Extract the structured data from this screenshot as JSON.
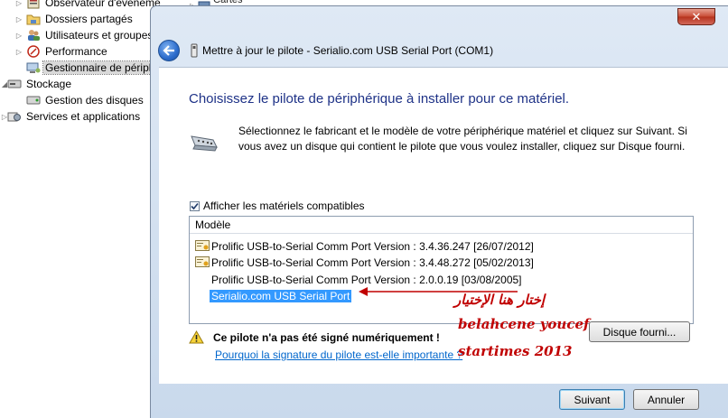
{
  "tree": {
    "items": [
      {
        "label": "Observateur d'événeme",
        "icon": "event-viewer-icon",
        "expander": "▷"
      },
      {
        "label": "Dossiers partagés",
        "icon": "shared-folder-icon",
        "expander": "▷"
      },
      {
        "label": "Utilisateurs et groupes",
        "icon": "users-icon",
        "expander": "▷"
      },
      {
        "label": "Performance",
        "icon": "performance-icon",
        "expander": "▷"
      },
      {
        "label": "Gestionnaire de périph",
        "icon": "device-manager-icon",
        "expander": ""
      },
      {
        "label": "Stockage",
        "icon": "storage-icon",
        "expander": "◢"
      },
      {
        "label": "Gestion des disques",
        "icon": "disk-icon",
        "expander": ""
      },
      {
        "label": "Services et applications",
        "icon": "services-icon",
        "expander": "▷"
      }
    ],
    "background_item": "Cartes réseau"
  },
  "dialog": {
    "close_label": "✕",
    "title": "Mettre à jour le pilote - Serialio.com USB Serial Port (COM1)",
    "heading": "Choisissez le pilote de périphérique à installer pour ce matériel.",
    "instructions": "Sélectionnez le fabricant et le modèle de votre périphérique matériel et cliquez sur Suivant. Si vous avez un disque qui contient le pilote que vous voulez installer, cliquez sur Disque fourni.",
    "show_compatible": {
      "label": "Afficher les matériels compatibles",
      "checked": true
    },
    "model_list": {
      "header": "Modèle",
      "rows": [
        {
          "label": "Prolific USB-to-Serial Comm Port Version : 3.4.36.247 [26/07/2012]",
          "icon": "certificate-icon",
          "selected": false
        },
        {
          "label": "Prolific USB-to-Serial Comm Port Version : 3.4.48.272 [05/02/2013]",
          "icon": "certificate-icon",
          "selected": false
        },
        {
          "label": "Prolific USB-to-Serial Comm Port Version : 2.0.0.19 [03/08/2005]",
          "icon": "",
          "selected": false
        },
        {
          "label": "Serialio.com USB Serial Port",
          "icon": "",
          "selected": true
        }
      ]
    },
    "warning": "Ce pilote n'a pas été signé numériquement !",
    "why_link": "Pourquoi la signature du pilote est-elle importante ?",
    "have_disk_label": "Disque fourni...",
    "next_label": "Suivant",
    "cancel_label": "Annuler"
  },
  "annotations": {
    "line1": "إختار هنا الإختيار",
    "line2": "belahcene youcef",
    "line3": "startimes 2013"
  },
  "colors": {
    "heading": "#1e3287",
    "selection": "#3399ff",
    "link": "#0066cc",
    "annotation": "#c00000"
  }
}
